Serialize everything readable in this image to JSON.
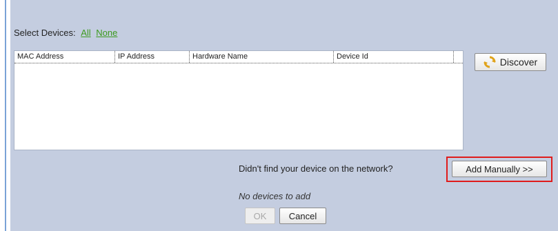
{
  "select_devices": {
    "label": "Select Devices:",
    "all_link": "All",
    "none_link": "None"
  },
  "device_table": {
    "columns": [
      "MAC Address",
      "IP Address",
      "Hardware Name",
      "Device Id"
    ],
    "rows": []
  },
  "discover_button": {
    "label": "Discover",
    "icon": "discover-refresh-icon"
  },
  "not_found_text": "Didn't find your device on the network?",
  "add_manually_button": {
    "label": "Add Manually >>"
  },
  "status_text": "No devices to add",
  "ok_button": {
    "label": "OK"
  },
  "cancel_button": {
    "label": "Cancel"
  },
  "colors": {
    "panel": "#c4cde0",
    "link": "#3c9a1e",
    "highlight": "#e01b1b",
    "left_border": "#7aa3d6"
  }
}
